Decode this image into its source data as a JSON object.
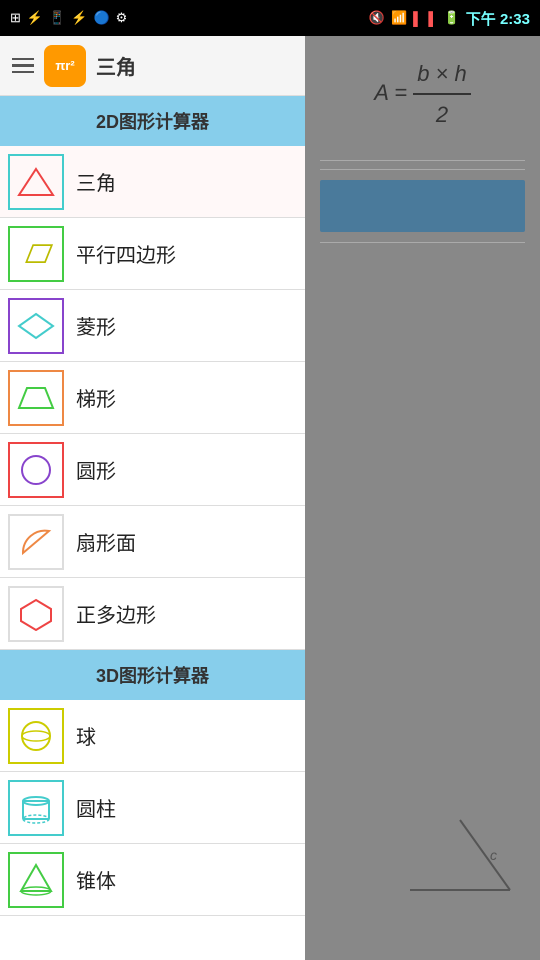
{
  "statusBar": {
    "time": "下午 2:33",
    "icons": [
      "usb",
      "phone",
      "wifi",
      "battery"
    ]
  },
  "header": {
    "appName": "三角",
    "logoText": "πr²"
  },
  "sidebar": {
    "section2d": "2D图形计算器",
    "section3d": "3D图形计算器",
    "items2d": [
      {
        "label": "三角",
        "shape": "triangle"
      },
      {
        "label": "平行四边形",
        "shape": "parallelogram"
      },
      {
        "label": "菱形",
        "shape": "rhombus"
      },
      {
        "label": "梯形",
        "shape": "trapezoid"
      },
      {
        "label": "圆形",
        "shape": "circle"
      },
      {
        "label": "扇形面",
        "shape": "sector"
      },
      {
        "label": "正多边形",
        "shape": "polygon"
      }
    ],
    "items3d": [
      {
        "label": "球",
        "shape": "sphere"
      },
      {
        "label": "圆柱",
        "shape": "cylinder"
      },
      {
        "label": "锥体",
        "shape": "cone"
      }
    ]
  },
  "formula": {
    "lhs": "A =",
    "numerator": "b × h",
    "denominator": "2"
  }
}
